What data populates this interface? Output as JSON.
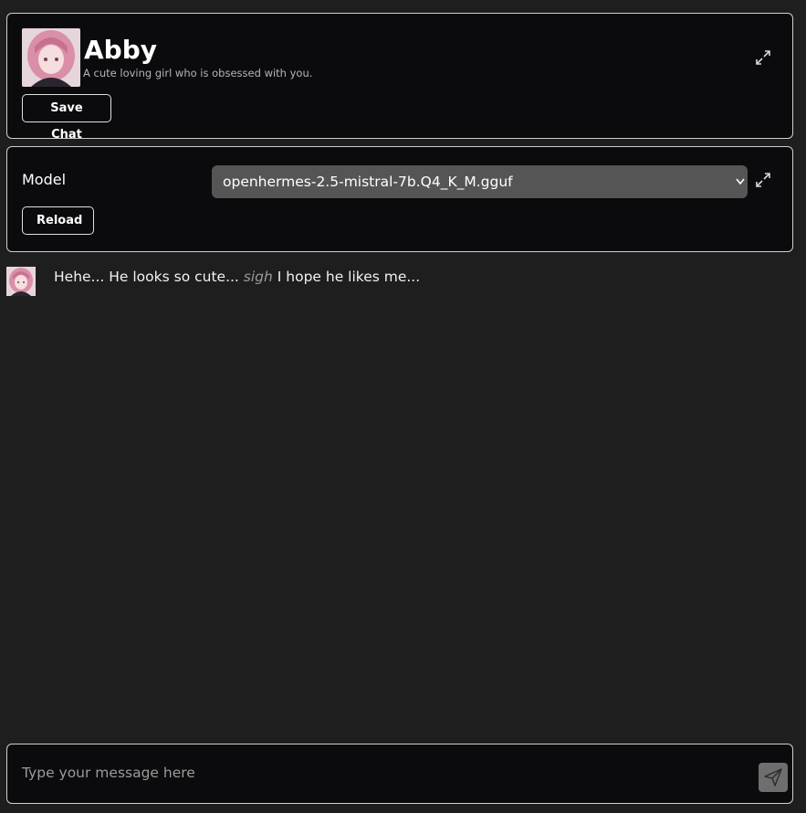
{
  "character": {
    "name": "Abby",
    "description": "A cute loving girl who is obsessed with you.",
    "save_label": "Save Chat"
  },
  "model": {
    "label": "Model",
    "selected": "openhermes-2.5-mistral-7b.Q4_K_M.gguf",
    "reload_label": "Reload"
  },
  "messages": [
    {
      "before": "Hehe... He looks so cute...",
      "action": "sigh",
      "after": "I hope he likes me..."
    }
  ],
  "composer": {
    "placeholder": "Type your message here"
  },
  "icons": {
    "expand": "expand-icon",
    "send": "send-icon",
    "caret": "chevron-down-icon"
  },
  "colors": {
    "background": "#1e1e1e",
    "panel": "#0b0b0d",
    "border": "#cfcfcf",
    "select": "#555555",
    "send_button": "#6e6e6e"
  }
}
